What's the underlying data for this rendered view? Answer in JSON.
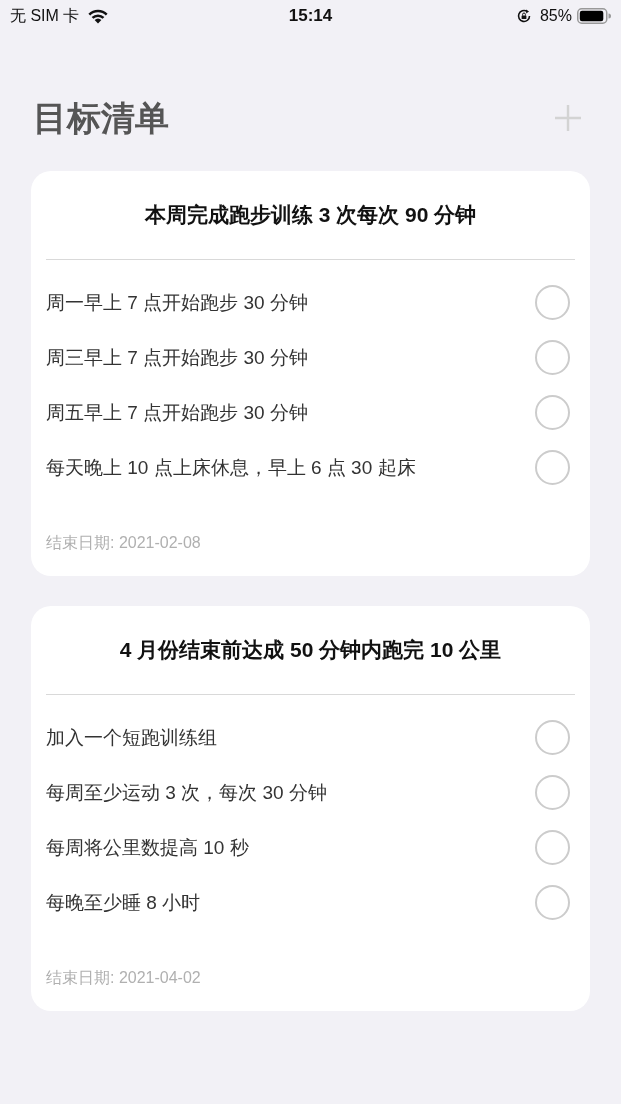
{
  "status_bar": {
    "carrier": "无 SIM 卡",
    "time": "15:14",
    "battery": "85%"
  },
  "header": {
    "title": "目标清单"
  },
  "goals": [
    {
      "title": "本周完成跑步训练 3 次每次 90 分钟",
      "tasks": [
        {
          "text": "周一早上 7 点开始跑步 30 分钟",
          "checked": false
        },
        {
          "text": "周三早上 7 点开始跑步 30 分钟",
          "checked": false
        },
        {
          "text": "周五早上 7 点开始跑步 30 分钟",
          "checked": false
        },
        {
          "text": "每天晚上 10 点上床休息，早上 6 点 30 起床",
          "checked": false
        }
      ],
      "end_date": "结束日期: 2021-02-08"
    },
    {
      "title": "4 月份结束前达成 50 分钟内跑完 10 公里",
      "tasks": [
        {
          "text": "加入一个短跑训练组",
          "checked": false
        },
        {
          "text": "每周至少运动 3 次，每次 30 分钟",
          "checked": false
        },
        {
          "text": "每周将公里数提高 10 秒",
          "checked": false
        },
        {
          "text": "每晚至少睡 8 小时",
          "checked": false
        }
      ],
      "end_date": "结束日期: 2021-04-02"
    }
  ]
}
